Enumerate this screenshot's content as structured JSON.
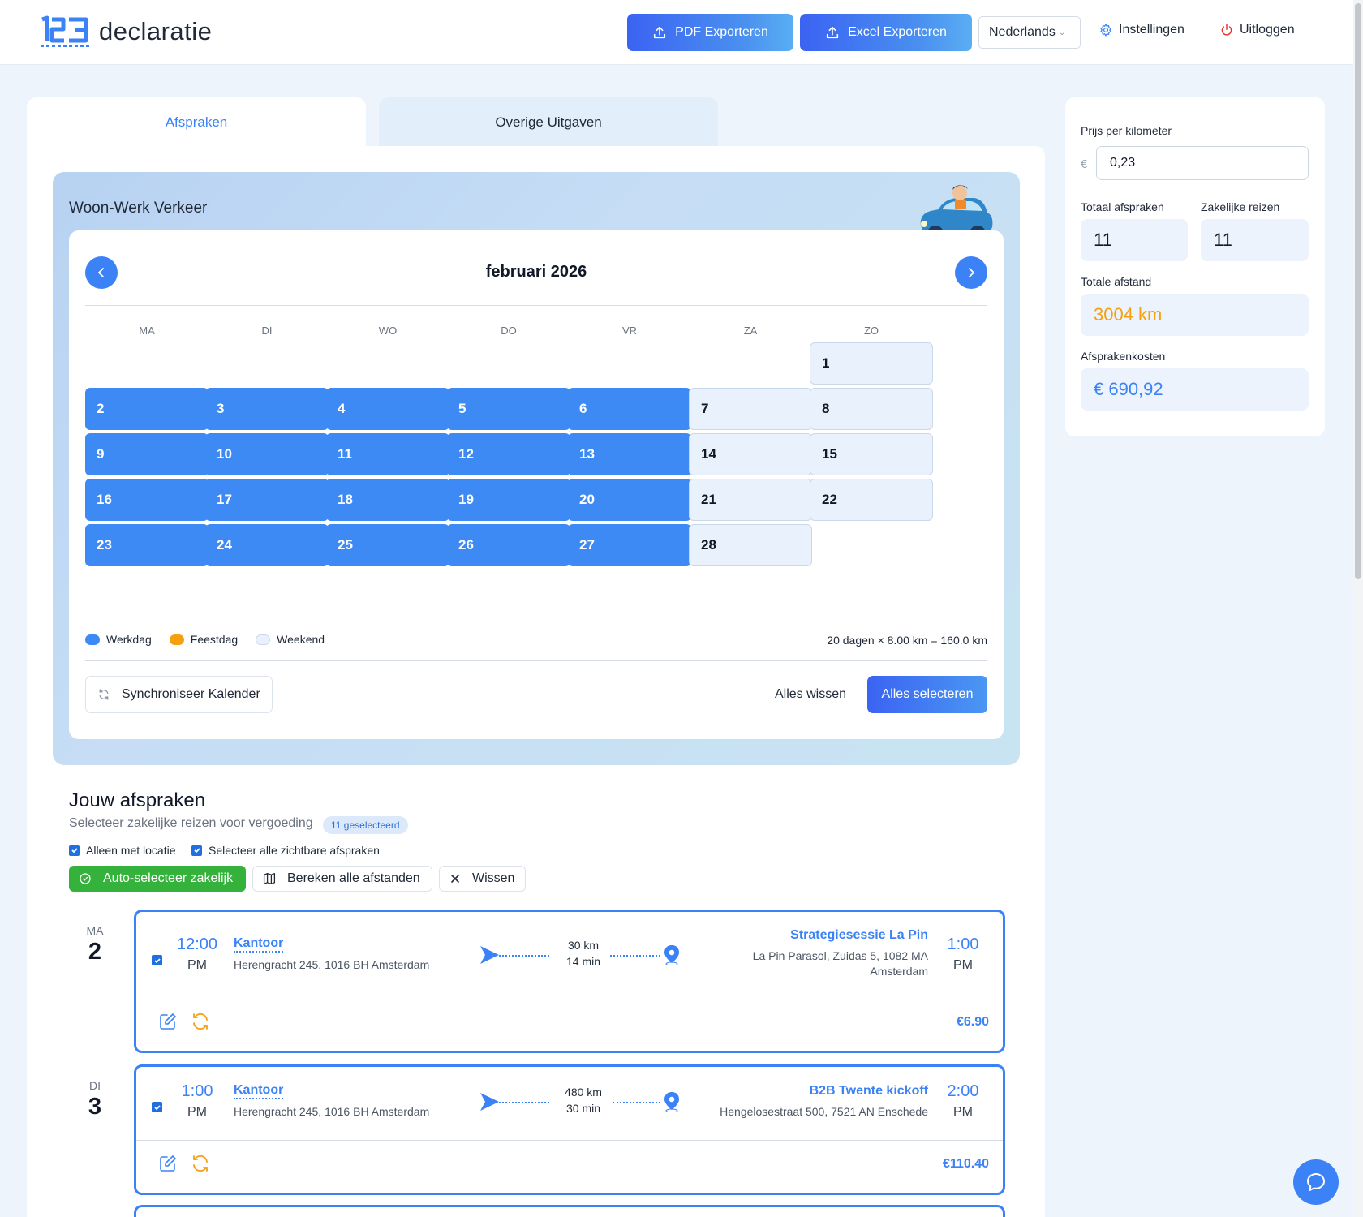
{
  "header": {
    "logo_text": "declaratie",
    "pdf_label": "PDF Exporteren",
    "excel_label": "Excel Exporteren",
    "language": "Nederlands",
    "settings_label": "Instellingen",
    "logout_label": "Uitloggen"
  },
  "tabs": [
    {
      "label": "Afspraken"
    },
    {
      "label": "Overige Uitgaven"
    }
  ],
  "calendar": {
    "title": "Woon-Werk Verkeer",
    "month": "februari 2026",
    "weekdays": [
      "MA",
      "DI",
      "WO",
      "DO",
      "VR",
      "ZA",
      "ZO"
    ],
    "days": [
      {
        "n": "1",
        "type": "weekend"
      },
      {
        "n": "2",
        "type": "work"
      },
      {
        "n": "3",
        "type": "work"
      },
      {
        "n": "4",
        "type": "work"
      },
      {
        "n": "5",
        "type": "work"
      },
      {
        "n": "6",
        "type": "work"
      },
      {
        "n": "7",
        "type": "weekend"
      },
      {
        "n": "8",
        "type": "weekend"
      },
      {
        "n": "9",
        "type": "work"
      },
      {
        "n": "10",
        "type": "work"
      },
      {
        "n": "11",
        "type": "work"
      },
      {
        "n": "12",
        "type": "work"
      },
      {
        "n": "13",
        "type": "work"
      },
      {
        "n": "14",
        "type": "weekend"
      },
      {
        "n": "15",
        "type": "weekend"
      },
      {
        "n": "16",
        "type": "work"
      },
      {
        "n": "17",
        "type": "work"
      },
      {
        "n": "18",
        "type": "work"
      },
      {
        "n": "19",
        "type": "work"
      },
      {
        "n": "20",
        "type": "work"
      },
      {
        "n": "21",
        "type": "weekend"
      },
      {
        "n": "22",
        "type": "weekend"
      },
      {
        "n": "23",
        "type": "work"
      },
      {
        "n": "24",
        "type": "work"
      },
      {
        "n": "25",
        "type": "work"
      },
      {
        "n": "26",
        "type": "work"
      },
      {
        "n": "27",
        "type": "work"
      },
      {
        "n": "28",
        "type": "weekend"
      }
    ],
    "legend": {
      "work": "Werkdag",
      "holiday": "Feestdag",
      "weekend": "Weekend"
    },
    "calculation": "20 dagen × 8.00 km = 160.0 km",
    "sync_label": "Synchroniseer Kalender",
    "clear_label": "Alles wissen",
    "select_label": "Alles selecteren",
    "colors": {
      "work": "#3e8af5",
      "holiday": "#f5a00f",
      "weekend": "#e8f1fc"
    }
  },
  "appointments": {
    "title": "Jouw afspraken",
    "subtitle": "Selecteer zakelijke reizen voor vergoeding",
    "badge": "11 geselecteerd",
    "only_location": "Alleen met locatie",
    "select_visible": "Selecteer alle zichtbare afspraken",
    "auto_select": "Auto-selecteer zakelijk",
    "calc_all": "Bereken alle afstanden",
    "clear": "Wissen",
    "items": [
      {
        "day": "MA",
        "date": "2",
        "start_time": "12:00",
        "start_ampm": "PM",
        "origin": "Kantoor",
        "origin_address": "Herengracht 245, 1016 BH Amsterdam",
        "distance": "30 km",
        "duration": "14 min",
        "destination": "Strategiesessie La Pin",
        "dest_address_1": "La Pin Parasol, Zuidas 5, 1082 MA",
        "dest_address_2": "Amsterdam",
        "end_time": "1:00",
        "end_ampm": "PM",
        "price": "€6.90"
      },
      {
        "day": "DI",
        "date": "3",
        "start_time": "1:00",
        "start_ampm": "PM",
        "origin": "Kantoor",
        "origin_address": "Herengracht 245, 1016 BH Amsterdam",
        "distance": "480 km",
        "duration": "30 min",
        "destination": "B2B Twente kickoff",
        "dest_address_1": "Hengelosestraat 500, 7521 AN Enschede",
        "end_time": "2:00",
        "end_ampm": "PM",
        "price": "€110.40"
      }
    ]
  },
  "sidebar": {
    "price_label": "Prijs per kilometer",
    "currency": "€",
    "price_value": "0,23",
    "total_label": "Totaal afspraken",
    "total_value": "11",
    "business_label": "Zakelijke reizen",
    "business_value": "11",
    "distance_label": "Totale afstand",
    "distance_value": "3004 km",
    "cost_label": "Afsprakenkosten",
    "cost_value": "€ 690,92",
    "accent_orange": "#f5a00f",
    "accent_blue": "#3b82f6"
  }
}
